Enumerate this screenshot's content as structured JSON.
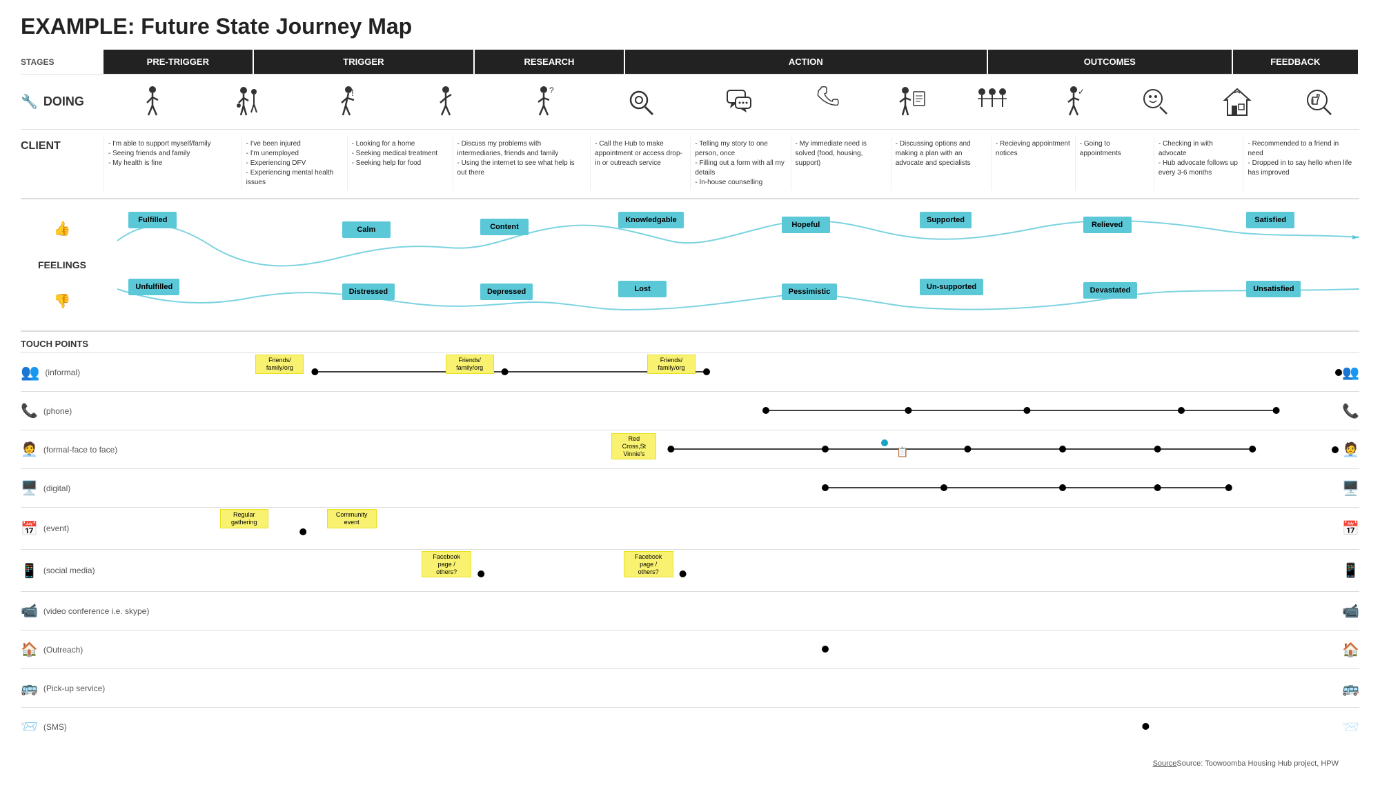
{
  "title": "EXAMPLE: Future State Journey Map",
  "stages_label": "STAGES",
  "stages": [
    {
      "id": "pretrigger",
      "label": "PRE-TRIGGER",
      "flex": 1.2
    },
    {
      "id": "trigger",
      "label": "TRIGGER",
      "flex": 1.8
    },
    {
      "id": "research",
      "label": "RESEARCH",
      "flex": 1.2
    },
    {
      "id": "action",
      "label": "ACTION",
      "flex": 3
    },
    {
      "id": "outcomes",
      "label": "OUTCOMES",
      "flex": 2
    },
    {
      "id": "feedback",
      "label": "FEEDBACK",
      "flex": 1
    }
  ],
  "doing_label": "DOING",
  "client_label": "CLIENT",
  "feelings_label": "FEELINGS",
  "touchpoints_label": "TOUCH POINTS",
  "client_texts": [
    "- I'm able to support myself/family\n- Seeing friends and family\n- My health is fine",
    "- I've been injured\n- I'm unemployed\n- Experiencing DFV\n- Experiencing mental health issues",
    "- Looking for a home\n- Seeking medical treatment\n- Seeking help for food",
    "- Discuss my problems with intermediaries, friends and family\n- Using the internet to see what help is out there",
    "- Call the Hub to make appointment or access drop-in or outreach service",
    "- Telling my story to one person, once\n- Filling out a form with all my details\n- In-house counselling",
    "- My immediate need is solved (food, housing, support)",
    "- Discussing options and making a plan with an advocate and specialists",
    "- Recieving appointment notices",
    "- Going to appointments",
    "- Checking in with advocate\n- Hub advocate follows up every 3-6 months",
    "- Recommended to a friend in need\n- Dropped in to say hello when life has improved"
  ],
  "feelings": {
    "positive": [
      "Fulfilled",
      "Calm",
      "Content",
      "Knowledgable",
      "Hopeful",
      "Supported",
      "Relieved",
      "Satisfied"
    ],
    "negative": [
      "Unfulfilled",
      "Distressed",
      "Depressed",
      "Lost",
      "Pessimistic",
      "Un-supported",
      "Devastated",
      "Unsatisfied"
    ]
  },
  "touchpoint_rows": [
    {
      "label": "(informal)",
      "icon": "👥"
    },
    {
      "label": "(phone)",
      "icon": "📞"
    },
    {
      "label": "(formal-face to face)",
      "icon": "🧑"
    },
    {
      "label": "(digital)",
      "icon": "🖥️"
    },
    {
      "label": "(event)",
      "icon": "📅"
    },
    {
      "label": "(social media)",
      "icon": "📱"
    },
    {
      "label": "(video conference i.e. skype)",
      "icon": "🎥"
    },
    {
      "label": "(Outreach)",
      "icon": "🏠"
    },
    {
      "label": "(Pick-up service)",
      "icon": "🚌"
    },
    {
      "label": "(SMS)",
      "icon": "📨"
    }
  ],
  "source": "Source: Toowoomba Housing Hub project, HPW"
}
